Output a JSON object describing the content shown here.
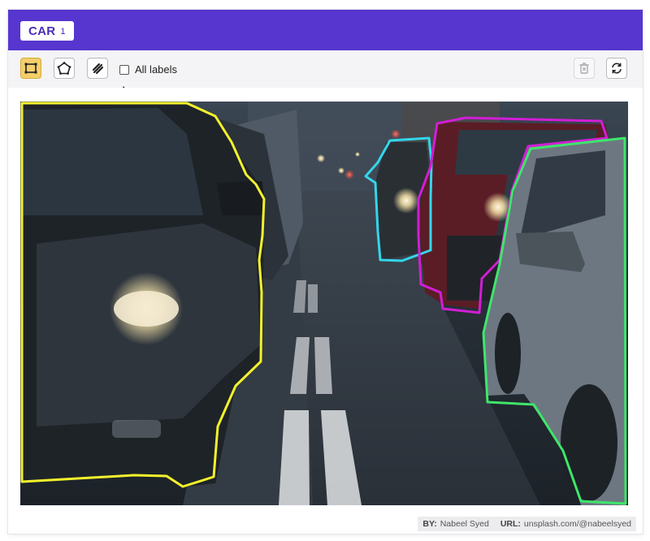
{
  "header": {
    "label_name": "CAR",
    "label_count": "1",
    "bg_color": "#5636cf"
  },
  "toolbar": {
    "tools": [
      {
        "name": "bounding-box-tool",
        "icon": "bounding-box-icon",
        "active": true
      },
      {
        "name": "polygon-tool",
        "icon": "polygon-icon",
        "active": false
      },
      {
        "name": "brush-tool",
        "icon": "brush-icon",
        "active": false
      }
    ],
    "all_labels_text": "All labels",
    "all_labels_checked": false,
    "right_tools": [
      {
        "name": "delete-tool",
        "icon": "trash-icon",
        "disabled": true
      },
      {
        "name": "reset-tool",
        "icon": "refresh-icon",
        "disabled": false
      }
    ]
  },
  "annotations": [
    {
      "label": "car",
      "color": "#f4f22c"
    },
    {
      "label": "car",
      "color": "#33d6ea"
    },
    {
      "label": "car",
      "color": "#d21ed6"
    },
    {
      "label": "car",
      "color": "#3ee66a"
    }
  ],
  "credit": {
    "by_label": "BY:",
    "by_value": "Nabeel Syed",
    "url_label": "URL:",
    "url_value": "unsplash.com/@nabeelsyed"
  }
}
